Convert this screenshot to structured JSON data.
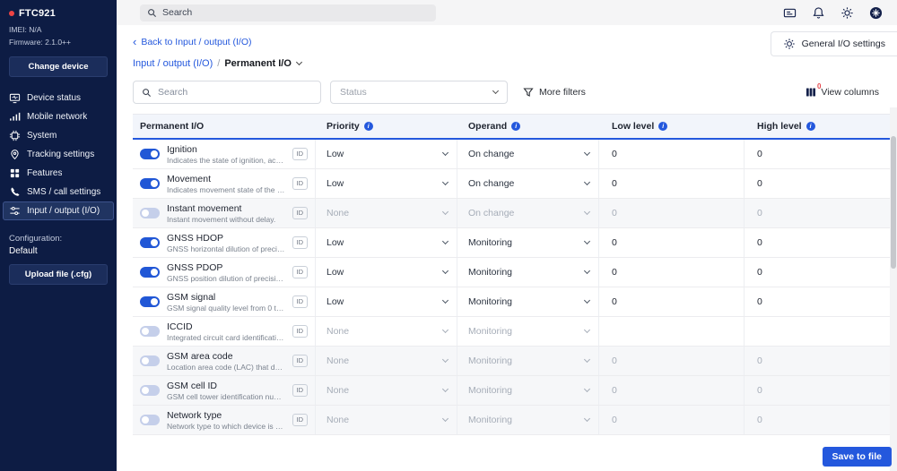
{
  "device_panel": {
    "name": "FTC921",
    "imei": "IMEI: N/A",
    "firmware": "Firmware: 2.1.0++",
    "change_device_button": "Change device",
    "configuration_label": "Configuration:",
    "configuration_value": "Default",
    "upload_button": "Upload file (.cfg)"
  },
  "sidebar_items": [
    {
      "label": "Device status",
      "icon": "device-status",
      "active": false
    },
    {
      "label": "Mobile network",
      "icon": "mobile-network",
      "active": false
    },
    {
      "label": "System",
      "icon": "system",
      "active": false
    },
    {
      "label": "Tracking settings",
      "icon": "tracking",
      "active": false
    },
    {
      "label": "Features",
      "icon": "features",
      "active": false
    },
    {
      "label": "SMS / call settings",
      "icon": "sms",
      "active": false
    },
    {
      "label": "Input / output (I/O)",
      "icon": "io",
      "active": true
    }
  ],
  "topbar": {
    "search_placeholder": "Search"
  },
  "page_header": {
    "back_link": "Back to Input / output (I/O)",
    "breadcrumb_parent": "Input / output (I/O)",
    "breadcrumb_separator": "/",
    "breadcrumb_current": "Permanent I/O",
    "general_settings_button": "General I/O settings"
  },
  "filter_bar": {
    "search_placeholder": "Search",
    "status_placeholder": "Status",
    "more_filters_label": "More filters",
    "view_columns_label": "View columns",
    "view_columns_badge": "0"
  },
  "table": {
    "id_badge": "ID",
    "headers": {
      "name": "Permanent I/O",
      "priority": "Priority",
      "operand": "Operand",
      "low": "Low level",
      "high": "High level"
    },
    "rows": [
      {
        "name": "Ignition",
        "description": "Indicates the state of ignition, acco...",
        "enabled": true,
        "dimmed": false,
        "priority": "Low",
        "operand": "On change",
        "low": "0",
        "high": "0"
      },
      {
        "name": "Movement",
        "description": "Indicates movement state of the d...",
        "enabled": true,
        "dimmed": false,
        "priority": "Low",
        "operand": "On change",
        "low": "0",
        "high": "0"
      },
      {
        "name": "Instant movement",
        "description": "Instant movement without delay.",
        "enabled": false,
        "dimmed": true,
        "priority": "None",
        "operand": "On change",
        "low": "0",
        "high": "0"
      },
      {
        "name": "GNSS HDOP",
        "description": "GNSS horizontal dilution of precisi...",
        "enabled": true,
        "dimmed": false,
        "priority": "Low",
        "operand": "Monitoring",
        "low": "0",
        "high": "0"
      },
      {
        "name": "GNSS PDOP",
        "description": "GNSS position dilution of precision...",
        "enabled": true,
        "dimmed": false,
        "priority": "Low",
        "operand": "Monitoring",
        "low": "0",
        "high": "0"
      },
      {
        "name": "GSM signal",
        "description": "GSM signal quality level from 0 to 5...",
        "enabled": true,
        "dimmed": false,
        "priority": "Low",
        "operand": "Monitoring",
        "low": "0",
        "high": "0"
      },
      {
        "name": "ICCID",
        "description": "Integrated circuit card identificatio...",
        "enabled": false,
        "dimmed": false,
        "priority": "None",
        "operand": "Monitoring",
        "low": "",
        "high": ""
      },
      {
        "name": "GSM area code",
        "description": "Location area code (LAC) that dep...",
        "enabled": false,
        "dimmed": true,
        "priority": "None",
        "operand": "Monitoring",
        "low": "0",
        "high": "0"
      },
      {
        "name": "GSM cell ID",
        "description": "GSM cell tower identification numb...",
        "enabled": false,
        "dimmed": true,
        "priority": "None",
        "operand": "Monitoring",
        "low": "0",
        "high": "0"
      },
      {
        "name": "Network type",
        "description": "Network type to which device is co...",
        "enabled": false,
        "dimmed": true,
        "priority": "None",
        "operand": "Monitoring",
        "low": "0",
        "high": "0"
      }
    ]
  },
  "footer": {
    "save_button": "Save to file"
  },
  "colors": {
    "accent": "#2458dd",
    "sidebar_bg": "#0d1c44",
    "danger": "#e5484d"
  }
}
